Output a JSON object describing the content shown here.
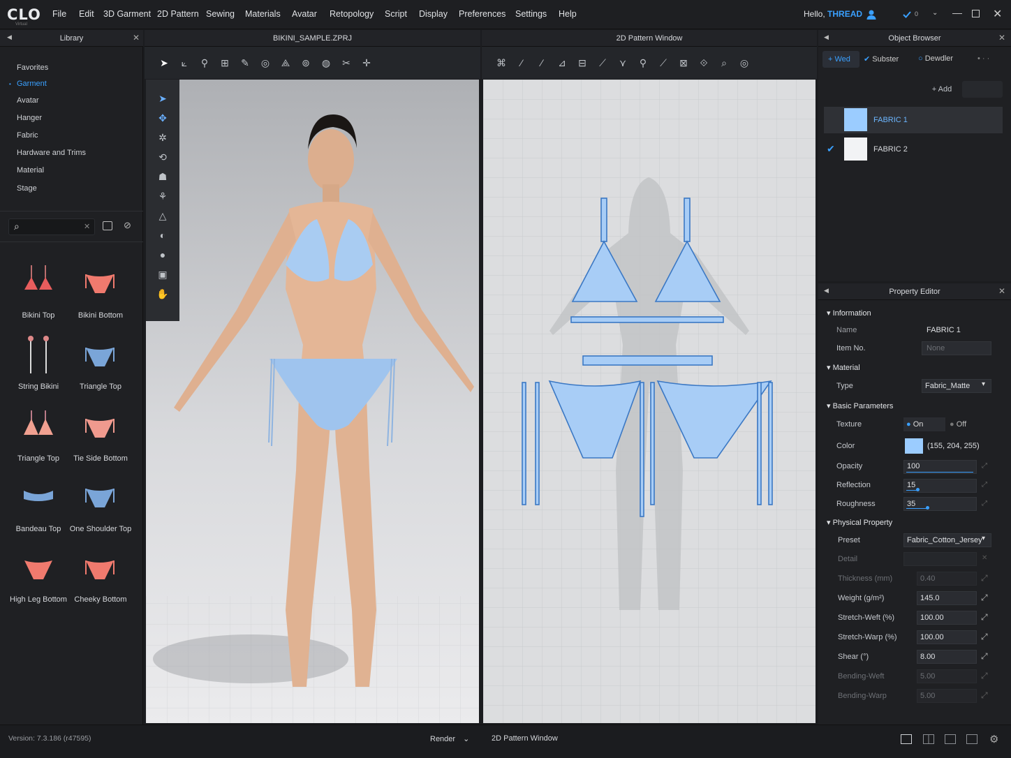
{
  "app": {
    "logo": "CLO",
    "logo_sub": "Virtual",
    "version": "Version: 7.3.186 (r47595)"
  },
  "menu": [
    "File",
    "Edit",
    "3D Garment",
    "2D Pattern",
    "Sewing",
    "Materials",
    "Avatar",
    "Retopology",
    "Script",
    "Display",
    "Preferences",
    "Settings",
    "Help"
  ],
  "user": {
    "hello": "Hello,",
    "name": "THREAD",
    "sync_count": "0"
  },
  "library": {
    "title": "Library",
    "items": [
      "Favorites",
      "Garment",
      "Avatar",
      "Hanger",
      "Fabric",
      "Hardware and Trims",
      "Material",
      "Stage"
    ],
    "active": "Garment",
    "thumbs": [
      "Bikini Top",
      "Bikini Bottom",
      "String Bikini",
      "Triangle Top",
      "Triangle Top",
      "Tie Side Bottom",
      "Bandeau Top",
      "One Shoulder Top",
      "High Leg Bottom",
      "Cheeky Bottom"
    ]
  },
  "viewport3d": {
    "title": "BIKINI_SAMPLE.ZPRJ",
    "render_label": "Render"
  },
  "pattern": {
    "title": "2D Pattern Window",
    "footer": "2D Pattern Window"
  },
  "object_browser": {
    "title": "Object Browser",
    "tabs": [
      "Wed",
      "Subster",
      "Dewdler"
    ],
    "add_label": "+ Add",
    "fabrics": [
      {
        "name": "FABRIC 1",
        "color": "#9bccff"
      },
      {
        "name": "FABRIC 2",
        "color": "#f2f3f5"
      }
    ]
  },
  "property_editor": {
    "title": "Property Editor",
    "information": "Information",
    "name_label": "Name",
    "name_value": "FABRIC 1",
    "item_label": "Item No.",
    "item_value": "None",
    "material": "Material",
    "type_label": "Type",
    "type_value": "Fabric_Matte",
    "basic": "Basic Parameters",
    "texture_label": "Texture",
    "on": "On",
    "off": "Off",
    "color_label": "Color",
    "color_value": "(155, 204, 255)",
    "color_hex": "#9bccff",
    "opacity_label": "Opacity",
    "opacity": "100",
    "reflection_label": "Reflection",
    "reflection": "15",
    "roughness_label": "Roughness",
    "roughness": "35",
    "physical": "Physical Property",
    "preset_label": "Preset",
    "preset_value": "Fabric_Cotton_Jersey",
    "detail_label": "Detail",
    "rows": [
      {
        "label": "Thickness (mm)",
        "value": "0.40",
        "dim": true
      },
      {
        "label": "Weight (g/m²)",
        "value": "145.0",
        "dim": false
      },
      {
        "label": "Stretch-Weft (%)",
        "value": "100.00",
        "dim": false
      },
      {
        "label": "Stretch-Warp (%)",
        "value": "100.00",
        "dim": false
      },
      {
        "label": "Shear (°)",
        "value": "8.00",
        "dim": false
      },
      {
        "label": "Bending-Weft",
        "value": "5.00",
        "dim": true
      },
      {
        "label": "Bending-Warp",
        "value": "5.00",
        "dim": true
      }
    ]
  }
}
